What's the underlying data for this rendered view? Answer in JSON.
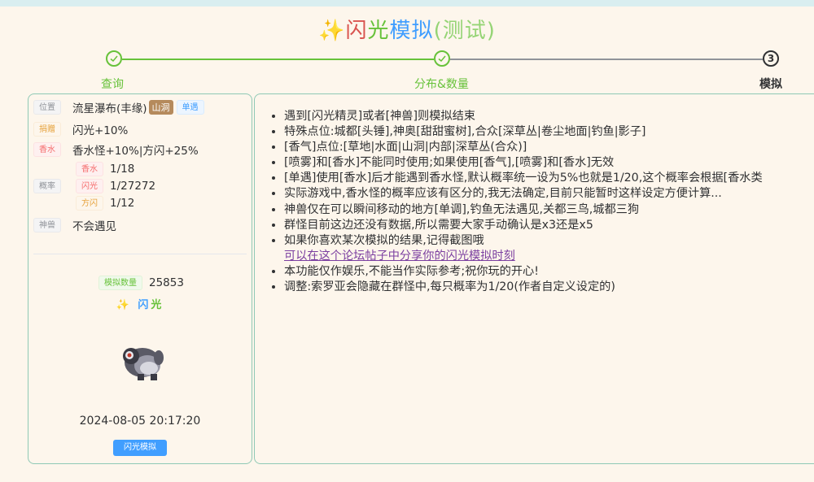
{
  "header": {
    "spark": "✨",
    "title_parts": [
      "闪",
      "光",
      "模拟",
      "(测试)"
    ]
  },
  "steps": [
    {
      "label": "查询",
      "state": "done",
      "icon": "check-icon"
    },
    {
      "label": "分布&数量",
      "state": "done",
      "icon": "check-icon"
    },
    {
      "label": "模拟",
      "state": "active",
      "number": "3"
    }
  ],
  "left": {
    "rows": {
      "location": {
        "tag": "位置",
        "text": "流星瀑布(丰缘)",
        "cave_tag": "山洞",
        "mode_tag": "单遇"
      },
      "donate": {
        "tag": "捐赠",
        "text": "闪光+10%"
      },
      "incense": {
        "tag": "香水",
        "text": "香水怪+10%|方闪+25%"
      },
      "rate": {
        "tag": "概率",
        "sub": [
          {
            "tag": "香水",
            "value": "1/18"
          },
          {
            "tag": "闪光",
            "value": "1/27272"
          },
          {
            "tag": "方闪",
            "value": "1/12"
          }
        ]
      },
      "legendary": {
        "tag": "神兽",
        "text": "不会遇见"
      }
    },
    "sim_count": {
      "tag": "模拟数量",
      "value": "25853"
    },
    "shiny": {
      "spark": "✨",
      "chars": [
        "闪",
        "光"
      ]
    },
    "sprite_icon": "pokemon-sprite",
    "datetime": "2024-08-05 20:17:20",
    "button": "闪光模拟"
  },
  "notes": [
    "遇到[闪光精灵]或者[神兽]则模拟结束",
    "特殊点位:城都[头锤],神奥[甜甜蜜树],合众[深草丛|卷尘地面|钓鱼|影子]",
    "[香气]点位:[草地|水面|山洞|内部|深草丛(合众)]",
    "[喷雾]和[香水]不能同时使用;如果使用[香气],[喷雾]和[香水]无效",
    "[单遇]使用[香水]后才能遇到香水怪,默认概率统一设为5%也就是1/20,这个概率会根据[香水类",
    "实际游戏中,香水怪的概率应该有区分的,我无法确定,目前只能暂时这样设定方便计算...",
    "神兽仅在可以瞬间移动的地方[单调],钓鱼无法遇见,关都三鸟,城都三狗",
    "群怪目前这边还没有数据,所以需要大家手动确认是x3还是x5",
    "如果你喜欢某次模拟的结果,记得截图哦",
    "本功能仅作娱乐,不能当作实际参考;祝你玩的开心!",
    "调整:索罗亚会隐藏在群怪中,每只概率为1/20(作者自定义设定的)"
  ],
  "notes_link": "可以在这个论坛帖子中分享你的闪光模拟时刻",
  "colors": {
    "accent_green": "#67c23a",
    "accent_blue": "#409eff",
    "panel_border": "#8fc9b5",
    "background": "#fdf6ec"
  }
}
